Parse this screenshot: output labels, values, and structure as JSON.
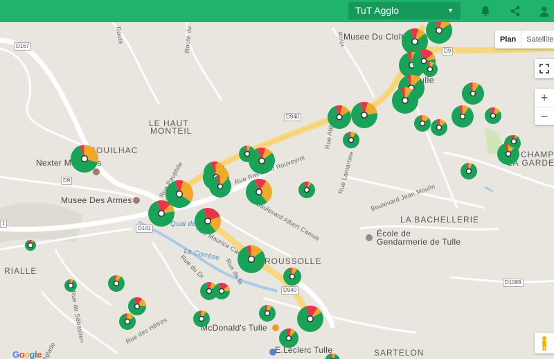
{
  "topbar": {
    "network_select": "TuT Agglo",
    "icons": [
      "bell-icon",
      "share-icon",
      "user-icon"
    ],
    "color": "#1fb36b"
  },
  "map": {
    "type_buttons": [
      "Plan",
      "Satellite"
    ],
    "active_type": "Plan",
    "zoom_in": "+",
    "zoom_out": "−",
    "provider": "Google",
    "labels": {
      "musee_cloitre": "Musee Du Cloître",
      "tulle": "Tulle",
      "le_haut": "LE HAUT",
      "monteil": "MONTEIL",
      "souilhac": "SOUILHAC",
      "nexter": "Nexter Munitions",
      "musee_armes": "Musee Des Armes",
      "champ": "CHAMP",
      "la_garde": "LA GARDE",
      "la_bachellerie": "LA BACHELLERIE",
      "ecole": "École de",
      "gendarmerie": "Gendarmerie de Tulle",
      "roussolle": "ROUSSOLLE",
      "sartelon": "SARTELON",
      "mcdonalds": "McDonald's Tulle",
      "leclerc": "E.Leclerc Tulle",
      "rialle": "RIALLE",
      "la_correze": "La Corrèze",
      "quai": "Quai de Tulle"
    },
    "streets": {
      "route_a": "Route",
      "route_b": "Route du",
      "rue_pauphile": "Rue Pauphile",
      "rue_raymond": "Rue Raymond Rouveyrol",
      "rue_abbe": "Rue Abbé Lair",
      "rue_lamartine": "Rue Lamartine",
      "bd_jean_moulin": "Boulevard Jean Moulin",
      "bd_albert": "Boulevard Albert Camus",
      "rue_maurice": "Rue Maurice Caquot",
      "rue_du_dr": "Rue du Dr",
      "rue_de_la": "Rue de la",
      "rue_des_hetres": "Rue des Hêtres",
      "rue_sebastien": "Rue de Sébastien",
      "roux": "Roux",
      "eglade": "églade"
    },
    "shields": {
      "d167": "D167",
      "d9_top": "D9",
      "d940_a": "D940",
      "d9_left": "D9",
      "d141": "D141",
      "d940_b": "D940",
      "d1089": "D1089",
      "d1_left": "1"
    },
    "pie_colors": {
      "green": "#18a358",
      "orange": "#f2a92b",
      "red": "#e9344a"
    }
  },
  "chart_data": {
    "type": "pie",
    "description_note": "",
    "stations": [
      {
        "id": 1,
        "r": 19,
        "green": 0.78,
        "orange": 0.12,
        "red": 0.1
      },
      {
        "id": 2,
        "r": 19,
        "green": 0.8,
        "orange": 0.1,
        "red": 0.1
      },
      {
        "id": 3,
        "r": 19,
        "green": 0.7,
        "orange": 0.25,
        "red": 0.05
      },
      {
        "id": 4,
        "r": 17,
        "green": 0.72,
        "orange": 0.08,
        "red": 0.2
      },
      {
        "id": 5,
        "r": 11,
        "green": 0.85,
        "orange": 0.1,
        "red": 0.05
      },
      {
        "id": 6,
        "r": 19,
        "green": 0.82,
        "orange": 0.13,
        "red": 0.05
      },
      {
        "id": 7,
        "r": 19,
        "green": 0.85,
        "orange": 0.1,
        "red": 0.05
      },
      {
        "id": 8,
        "r": 16,
        "green": 0.85,
        "orange": 0.1,
        "red": 0.05
      },
      {
        "id": 9,
        "r": 12,
        "green": 0.8,
        "orange": 0.15,
        "red": 0.05
      },
      {
        "id": 10,
        "r": 16,
        "green": 0.85,
        "orange": 0.1,
        "red": 0.05
      },
      {
        "id": 11,
        "r": 12,
        "green": 0.8,
        "orange": 0.12,
        "red": 0.08
      },
      {
        "id": 12,
        "r": 12,
        "green": 0.78,
        "orange": 0.12,
        "red": 0.1
      },
      {
        "id": 13,
        "r": 12,
        "green": 0.85,
        "orange": 0.1,
        "red": 0.05
      },
      {
        "id": 14,
        "r": 16,
        "green": 0.82,
        "orange": 0.13,
        "red": 0.05
      },
      {
        "id": 15,
        "r": 9,
        "green": 0.85,
        "orange": 0.05,
        "red": 0.1
      },
      {
        "id": 16,
        "r": 12,
        "green": 0.88,
        "orange": 0.07,
        "red": 0.05
      },
      {
        "id": 17,
        "r": 12,
        "green": 0.85,
        "orange": 0.1,
        "red": 0.05
      },
      {
        "id": 18,
        "r": 19,
        "green": 0.72,
        "orange": 0.18,
        "red": 0.1
      },
      {
        "id": 19,
        "r": 17,
        "green": 0.78,
        "orange": 0.12,
        "red": 0.1
      },
      {
        "id": 20,
        "r": 20,
        "green": 0.65,
        "orange": 0.3,
        "red": 0.05
      },
      {
        "id": 21,
        "r": 12,
        "green": 0.88,
        "orange": 0.07,
        "red": 0.05
      },
      {
        "id": 22,
        "r": 19,
        "green": 0.8,
        "orange": 0.1,
        "red": 0.1
      },
      {
        "id": 23,
        "r": 16,
        "green": 0.8,
        "orange": 0.1,
        "red": 0.1
      },
      {
        "id": 24,
        "r": 19,
        "green": 0.7,
        "orange": 0.25,
        "red": 0.05
      },
      {
        "id": 25,
        "r": 19,
        "green": 0.72,
        "orange": 0.1,
        "red": 0.18
      },
      {
        "id": 26,
        "r": 20,
        "green": 0.6,
        "orange": 0.3,
        "red": 0.1
      },
      {
        "id": 27,
        "r": 16,
        "green": 0.82,
        "orange": 0.13,
        "red": 0.05
      },
      {
        "id": 28,
        "r": 19,
        "green": 0.55,
        "orange": 0.3,
        "red": 0.15
      },
      {
        "id": 29,
        "r": 19,
        "green": 0.55,
        "orange": 0.2,
        "red": 0.25
      },
      {
        "id": 30,
        "r": 20,
        "green": 0.8,
        "orange": 0.15,
        "red": 0.05
      },
      {
        "id": 31,
        "r": 12,
        "green": 0.85,
        "orange": 0.05,
        "red": 0.1
      },
      {
        "id": 32,
        "r": 13,
        "green": 0.85,
        "orange": 0.1,
        "red": 0.05
      },
      {
        "id": 33,
        "r": 9,
        "green": 0.88,
        "orange": 0.07,
        "red": 0.05
      },
      {
        "id": 34,
        "r": 12,
        "green": 0.85,
        "orange": 0.1,
        "red": 0.05
      },
      {
        "id": 35,
        "r": 13,
        "green": 0.8,
        "orange": 0.1,
        "red": 0.1
      },
      {
        "id": 36,
        "r": 12,
        "green": 0.7,
        "orange": 0.1,
        "red": 0.2
      },
      {
        "id": 37,
        "r": 13,
        "green": 0.7,
        "orange": 0.15,
        "red": 0.15
      },
      {
        "id": 38,
        "r": 12,
        "green": 0.85,
        "orange": 0.1,
        "red": 0.05
      },
      {
        "id": 39,
        "r": 19,
        "green": 0.78,
        "orange": 0.07,
        "red": 0.15
      },
      {
        "id": 40,
        "r": 12,
        "green": 0.85,
        "orange": 0.1,
        "red": 0.05
      },
      {
        "id": 41,
        "r": 12,
        "green": 0.8,
        "orange": 0.15,
        "red": 0.05
      },
      {
        "id": 42,
        "r": 8,
        "green": 0.85,
        "orange": 0.05,
        "red": 0.1
      },
      {
        "id": 43,
        "r": 14,
        "green": 0.82,
        "orange": 0.08,
        "red": 0.1
      },
      {
        "id": 44,
        "r": 11,
        "green": 0.88,
        "orange": 0.07,
        "red": 0.05
      }
    ]
  }
}
